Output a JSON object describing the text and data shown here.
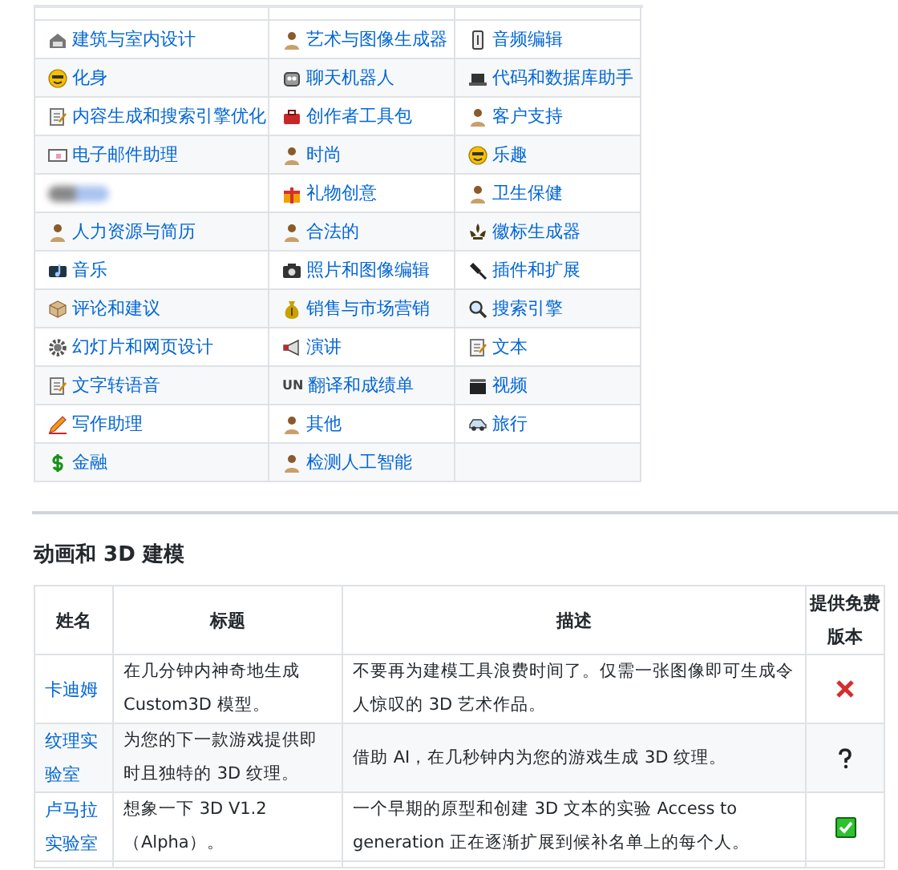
{
  "categories": [
    {
      "kind": "link",
      "label": "建筑与室内设计"
    },
    {
      "kind": "link",
      "label": "艺术与图像生成器"
    },
    {
      "kind": "link",
      "label": "音频编辑"
    },
    {
      "kind": "link",
      "label": "化身"
    },
    {
      "kind": "link",
      "label": "聊天机器人"
    },
    {
      "kind": "link",
      "label": "代码和数据库助手"
    },
    {
      "kind": "link",
      "label": "内容生成和搜索引擎优化"
    },
    {
      "kind": "link",
      "label": "创作者工具包"
    },
    {
      "kind": "link",
      "label": "客户支持"
    },
    {
      "kind": "link",
      "label": "电子邮件助理"
    },
    {
      "kind": "link",
      "label": "时尚"
    },
    {
      "kind": "link",
      "label": "乐趣"
    },
    {
      "kind": "blurred"
    },
    {
      "kind": "link",
      "label": "礼物创意"
    },
    {
      "kind": "link",
      "label": "卫生保健"
    },
    {
      "kind": "link",
      "label": "人力资源与简历"
    },
    {
      "kind": "link",
      "label": "合法的"
    },
    {
      "kind": "link",
      "label": "徽标生成器"
    },
    {
      "kind": "link",
      "label": "音乐"
    },
    {
      "kind": "link",
      "label": "照片和图像编辑"
    },
    {
      "kind": "link",
      "label": "插件和扩展"
    },
    {
      "kind": "link",
      "label": "评论和建议"
    },
    {
      "kind": "link",
      "label": "销售与市场营销"
    },
    {
      "kind": "link",
      "label": "搜索引擎"
    },
    {
      "kind": "link",
      "label": "幻灯片和网页设计"
    },
    {
      "kind": "link",
      "label": "演讲"
    },
    {
      "kind": "link",
      "label": "文本"
    },
    {
      "kind": "link",
      "label": "文字转语音"
    },
    {
      "kind": "link",
      "label": "翻译和成绩单",
      "icon_text": "UN"
    },
    {
      "kind": "link",
      "label": "视频"
    },
    {
      "kind": "link",
      "label": "写作助理"
    },
    {
      "kind": "link",
      "label": "其他"
    },
    {
      "kind": "link",
      "label": "旅行"
    },
    {
      "kind": "link",
      "label": "金融"
    },
    {
      "kind": "link",
      "label": "检测人工智能"
    }
  ],
  "section": {
    "heading": "动画和 3D 建模",
    "columns": [
      "姓名",
      "标题",
      "描述",
      "提供免费版本"
    ],
    "rows": [
      {
        "name": "卡迪姆",
        "title": "在几分钟内神奇地生成 Custom3D 模型。",
        "description": "不要再为建模工具浪费时间了。仅需一张图像即可生成令人惊叹的 3D 艺术作品。",
        "kind": "no"
      },
      {
        "name": "纹理实验室",
        "title": "为您的下一款游戏提供即时且独特的 3D 纹理。",
        "description": "借助 AI，在几秒钟内为您的游戏生成 3D 纹理。",
        "kind": "unknown"
      },
      {
        "name": "卢马拉实验室",
        "title": "想象一下 3D V1.2（Alpha）。",
        "description": "一个早期的原型和创建 3D 文本的实验 Access to generation 正在逐渐扩展到候补名单上的每个人。",
        "kind": "yes"
      }
    ]
  }
}
